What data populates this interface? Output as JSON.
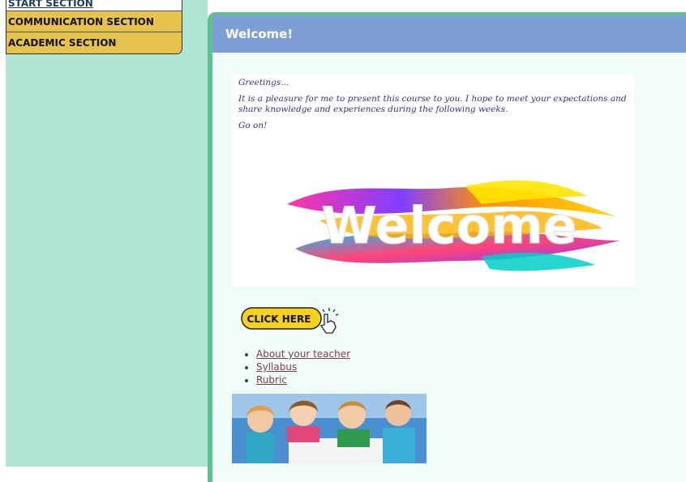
{
  "menu": {
    "items": [
      {
        "label": "START SECTION"
      },
      {
        "label": "COMMUNICATION SECTION"
      },
      {
        "label": "ACADEMIC SECTION"
      }
    ]
  },
  "panel": {
    "title": "Welcome!",
    "greeting": {
      "line1": "Greetings...",
      "line2": "It is a pleasure for me to present this course to you. I hope to meet your expectations and share knowledge and experiences during the following weeks.",
      "line3": "Go on!"
    },
    "banner_word": "Welcome",
    "click_here_label": "CLICK HERE",
    "links": [
      {
        "label": "About your teacher"
      },
      {
        "label": "Syllabus"
      },
      {
        "label": "Rubric"
      }
    ]
  },
  "colors": {
    "sidebar_bg": "#b0e6d2",
    "menu_gold": "#e6c24e",
    "header_blue": "#7e9fd6",
    "panel_border": "#5fc08f"
  }
}
